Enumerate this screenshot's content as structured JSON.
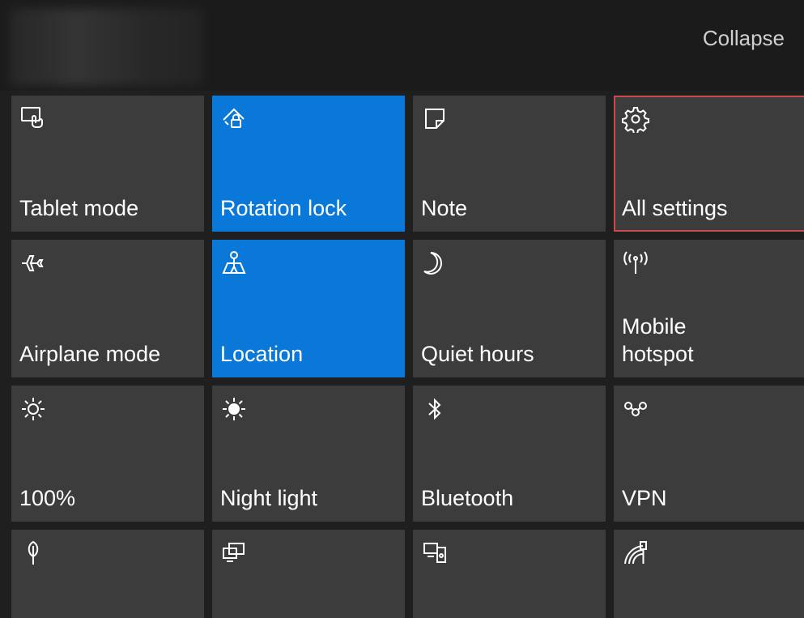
{
  "header": {
    "collapse_label": "Collapse"
  },
  "tiles": [
    {
      "label": "Tablet mode",
      "icon": "tablet-mode-icon",
      "active": false
    },
    {
      "label": "Rotation lock",
      "icon": "rotation-lock-icon",
      "active": true
    },
    {
      "label": "Note",
      "icon": "note-icon",
      "active": false
    },
    {
      "label": "All settings",
      "icon": "gear-icon",
      "active": false,
      "selected": true
    },
    {
      "label": "Airplane mode",
      "icon": "airplane-icon",
      "active": false
    },
    {
      "label": "Location",
      "icon": "location-icon",
      "active": true
    },
    {
      "label": "Quiet hours",
      "icon": "moon-icon",
      "active": false
    },
    {
      "label": "Mobile\nhotspot",
      "icon": "hotspot-icon",
      "active": false
    },
    {
      "label": "100%",
      "icon": "brightness-icon",
      "active": false
    },
    {
      "label": "Night light",
      "icon": "night-light-icon",
      "active": false
    },
    {
      "label": "Bluetooth",
      "icon": "bluetooth-icon",
      "active": false
    },
    {
      "label": "VPN",
      "icon": "vpn-icon",
      "active": false
    },
    {
      "label": "",
      "icon": "battery-saver-icon",
      "active": false
    },
    {
      "label": "",
      "icon": "project-icon",
      "active": false
    },
    {
      "label": "",
      "icon": "connect-icon",
      "active": false
    },
    {
      "label": "",
      "icon": "network-icon",
      "active": false
    }
  ],
  "colors": {
    "tile": "#3c3c3c",
    "active_tile": "#0a78d8",
    "selection_outline": "#c94c4c",
    "background": "#1f1f1f"
  }
}
